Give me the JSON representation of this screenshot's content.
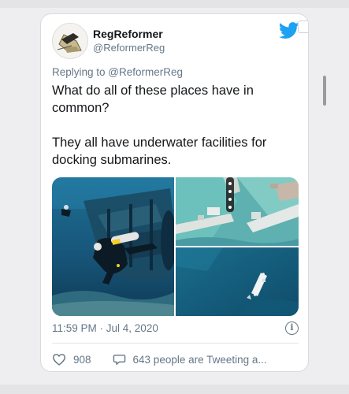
{
  "tweet": {
    "display_name": "RegReformer",
    "handle": "@ReformerReg",
    "replying_to": "Replying to @ReformerReg",
    "text_line1": "What do all of these places have in common?",
    "text_line2": "They all have underwater facilities for docking submarines.",
    "timestamp": "11:59 PM · Jul 4, 2020",
    "likes": "908",
    "tweeting": "643 people are Tweeting a..."
  },
  "icons": {
    "brand": "twitter-bird-icon",
    "info": "info-icon",
    "like": "heart-icon",
    "reply": "speech-bubble-icon"
  },
  "colors": {
    "twitter_blue": "#1da1f2",
    "secondary_text": "#657786",
    "primary_text": "#14171a"
  }
}
